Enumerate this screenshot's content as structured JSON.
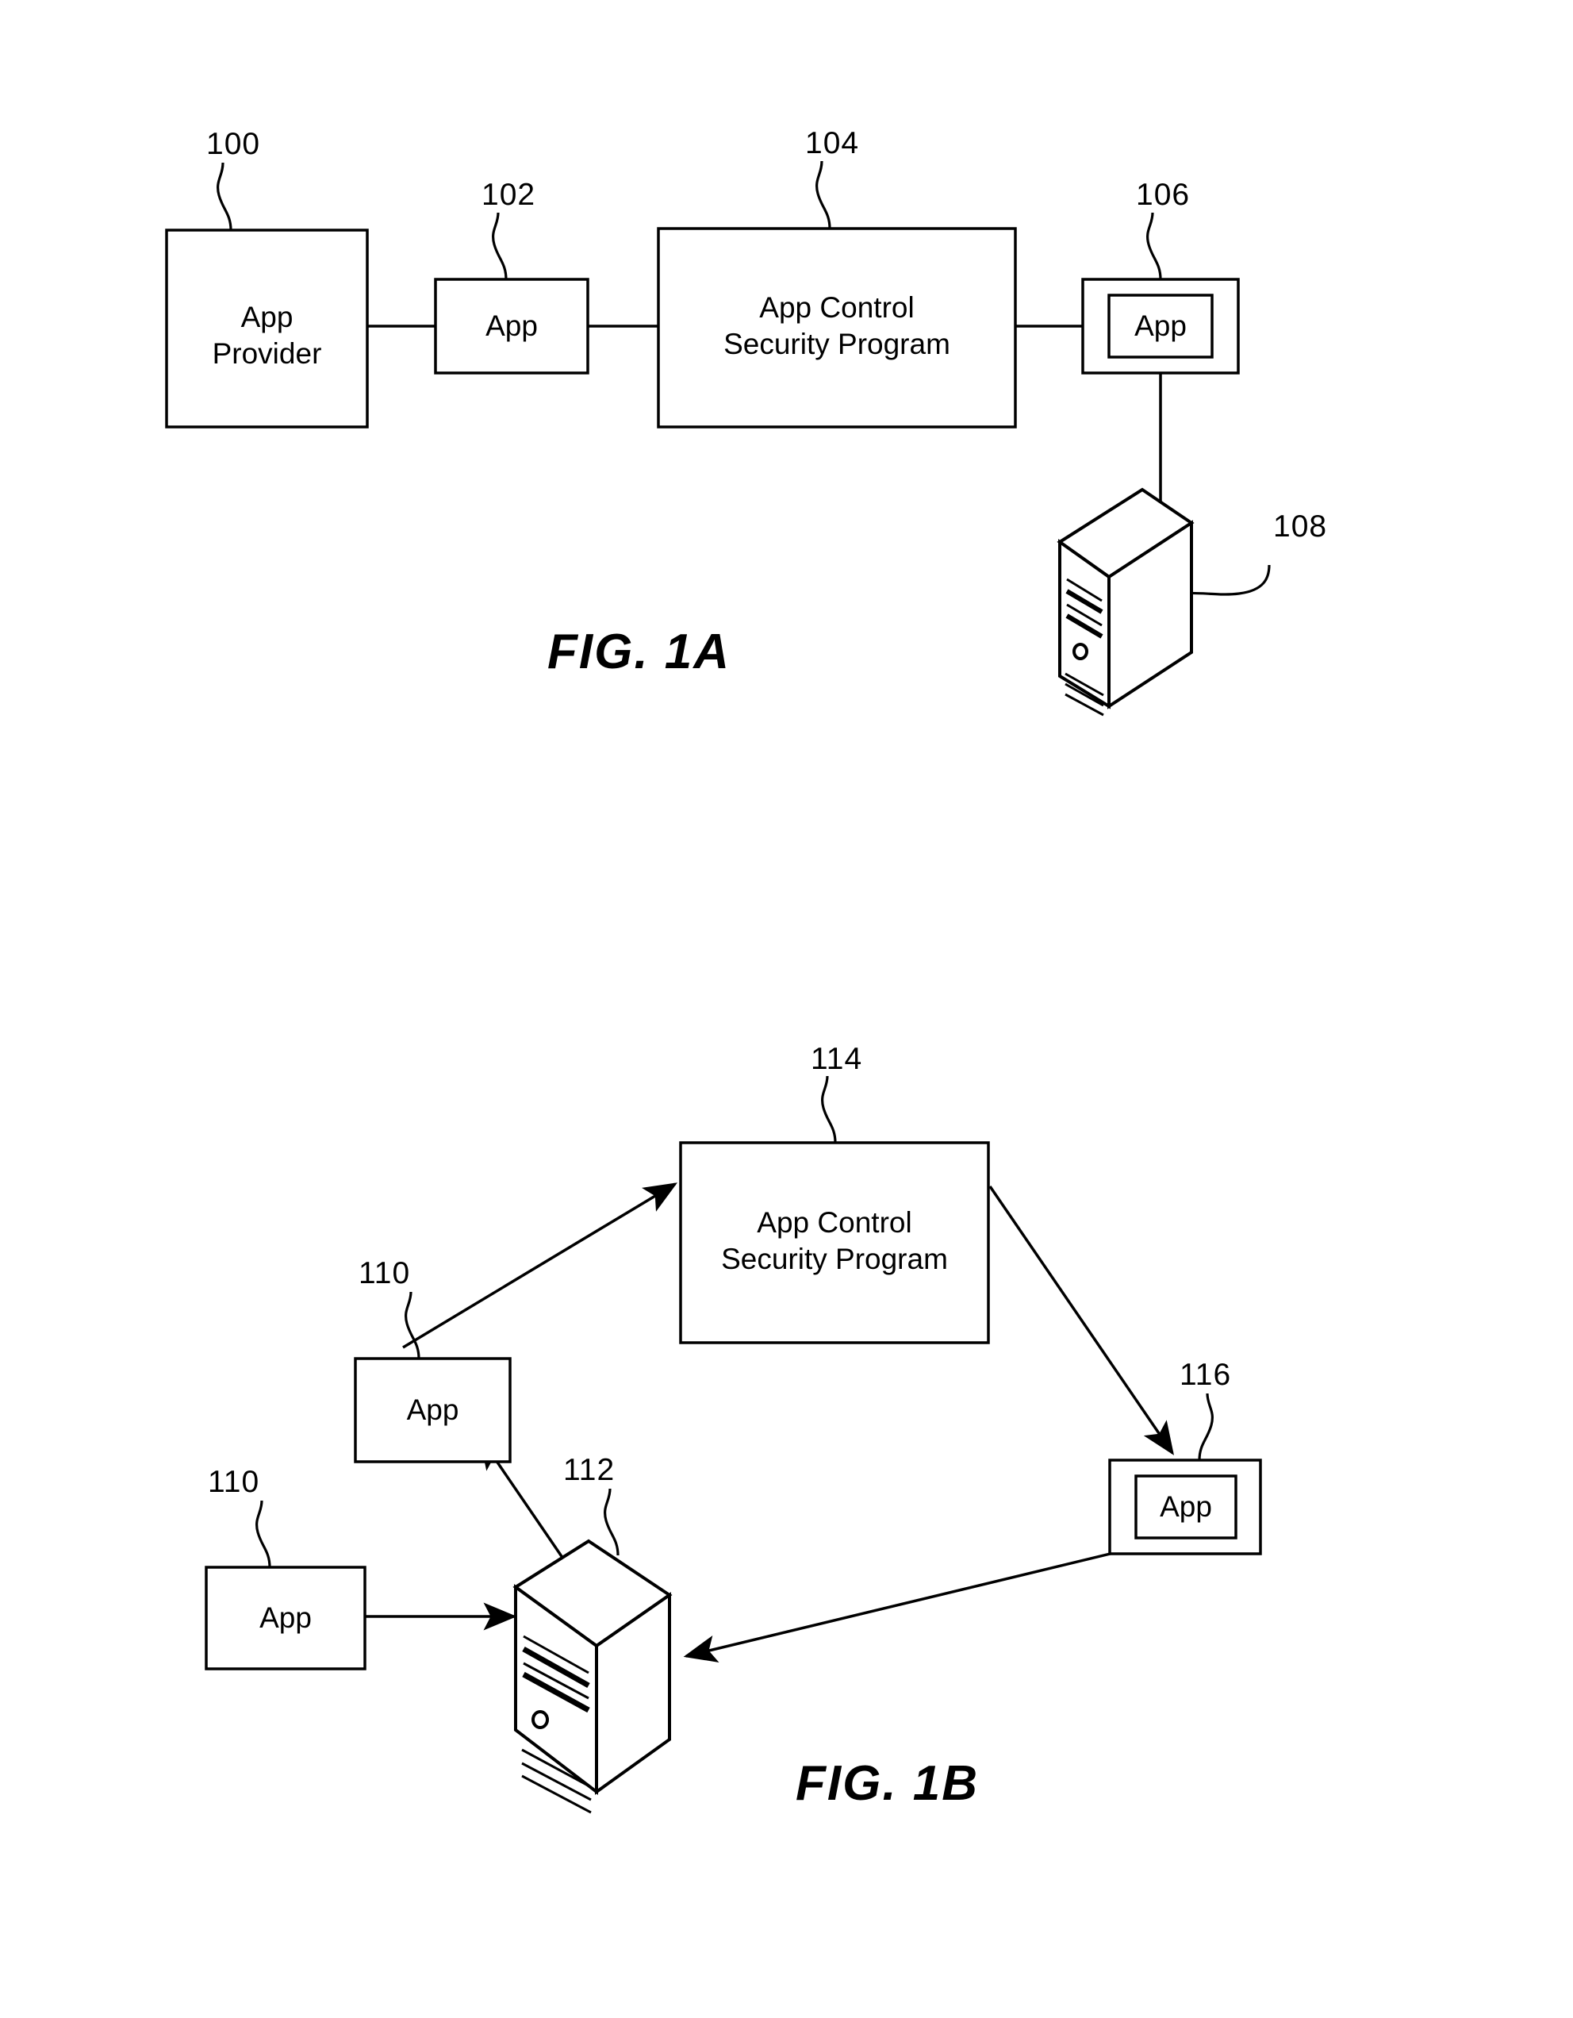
{
  "document": {
    "type": "patent-figure-sheet",
    "background_color": "#ffffff",
    "line_color": "#000000"
  },
  "figures": [
    {
      "id": "fig-1a",
      "caption": "FIG. 1A",
      "nodes": [
        {
          "ref": "100",
          "label": "App\nProvider",
          "shape": "rect"
        },
        {
          "ref": "102",
          "label": "App",
          "shape": "rect"
        },
        {
          "ref": "104",
          "label": "App Control\nSecurity Program",
          "shape": "rect"
        },
        {
          "ref": "106",
          "label": "App",
          "shape": "nested-rect"
        },
        {
          "ref": "108",
          "label": "",
          "shape": "server-tower"
        }
      ],
      "connections": [
        {
          "from": "100",
          "to": "102",
          "style": "plain-line"
        },
        {
          "from": "102",
          "to": "104",
          "style": "plain-line"
        },
        {
          "from": "104",
          "to": "106",
          "style": "plain-line"
        },
        {
          "from": "106",
          "to": "108",
          "style": "plain-line"
        }
      ]
    },
    {
      "id": "fig-1b",
      "caption": "FIG. 1B",
      "nodes": [
        {
          "ref": "114",
          "label": "App Control\nSecurity Program",
          "shape": "rect"
        },
        {
          "ref": "110",
          "label": "App",
          "shape": "rect",
          "position": "middle-left"
        },
        {
          "ref": "110",
          "label": "App",
          "shape": "rect",
          "position": "bottom-left"
        },
        {
          "ref": "112",
          "label": "",
          "shape": "server-tower"
        },
        {
          "ref": "116",
          "label": "App",
          "shape": "nested-rect"
        }
      ],
      "connections": [
        {
          "from": "110-middle",
          "to": "114",
          "style": "arrow"
        },
        {
          "from": "114",
          "to": "116",
          "style": "arrow"
        },
        {
          "from": "116",
          "to": "112",
          "style": "arrow"
        },
        {
          "from": "112",
          "to": "110-middle",
          "style": "arrow"
        },
        {
          "from": "110-bottom",
          "to": "112",
          "style": "arrow"
        }
      ]
    }
  ],
  "fig1a": {
    "caption": "FIG. 1A",
    "app_provider": {
      "ref": "100",
      "label": "App\nProvider"
    },
    "app_1": {
      "ref": "102",
      "label": "App"
    },
    "security_program": {
      "ref": "104",
      "label": "App Control\nSecurity Program"
    },
    "app_2": {
      "ref": "106",
      "label": "App"
    },
    "server": {
      "ref": "108",
      "name": "server-tower"
    }
  },
  "fig1b": {
    "caption": "FIG. 1B",
    "security_program": {
      "ref": "114",
      "label": "App Control\nSecurity Program"
    },
    "app_middle": {
      "ref": "110",
      "label": "App"
    },
    "app_bottom": {
      "ref": "110",
      "label": "App"
    },
    "server": {
      "ref": "112",
      "name": "server-tower"
    },
    "app_right": {
      "ref": "116",
      "label": "App"
    }
  }
}
